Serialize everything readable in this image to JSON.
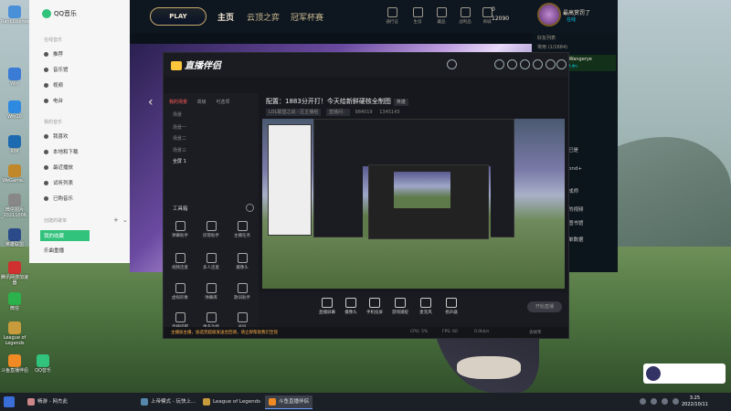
{
  "desktop": {
    "icons": [
      "RankLicense",
      "Win",
      "Win10",
      "RIM",
      "WeGame...",
      "微信图片_20211006...",
      "英雄联盟",
      "腾讯网游加速器",
      "微信",
      "League of Legends",
      "斗鱼直播伴侣",
      "QQ音乐"
    ]
  },
  "qqmusic": {
    "app_name": "QQ音乐",
    "online_section": "在线音乐",
    "online_items": [
      "推荐",
      "音乐馆",
      "视频",
      "电台"
    ],
    "my_section": "我的音乐",
    "my_items": [
      "我喜欢",
      "本地和下载",
      "最近播放",
      "试听列表",
      "已购音乐"
    ],
    "created_section": "创建的歌单",
    "playlists": [
      "我的收藏",
      "乐曲重播"
    ],
    "add_symbol": "+",
    "collapse_symbol": "⌄"
  },
  "lol": {
    "play_label": "PLAY",
    "nav": [
      "主页",
      "云顶之弈",
      "冠军杯赛"
    ],
    "top_icons": [
      "通行证",
      "生涯",
      "藏品",
      "战利品",
      "商城"
    ],
    "currency_be": "0",
    "currency_rp": "12090",
    "username": "最高赏罚了",
    "user_status": "在线",
    "friends_header": "好友列表",
    "friends_group": "常用 (1/1684)",
    "friend_name": "DandhenWangerye",
    "friend_status": "在线 (在选人中)",
    "right_side_labels": [
      "已是",
      "ond+",
      "成师",
      "的视频",
      "图书馆",
      "单数据"
    ]
  },
  "stream": {
    "app_title": "直播伴侣",
    "tabs": [
      "我的场景",
      "高级",
      "可选项"
    ],
    "scenes": [
      "场景",
      "场景一",
      "场景二",
      "场景三",
      "全屏 1"
    ],
    "tools_header": "工具箱",
    "tools": [
      "弹幕助手",
      "房管助手",
      "主播任务",
      "视频连麦",
      "多人连麦",
      "摄像头",
      "虚拟形象",
      "弹幕库",
      "歌词助手",
      "直播提醒",
      "更多功能",
      "录屏"
    ],
    "room_title": "配置：1883分开打！今天给新鲜硬核全制图",
    "room_tag": "英雄",
    "category": "LOL联盟之战 - 区主播组",
    "room_no": "直播间：",
    "viewers": "984019",
    "fans": "1345143",
    "bottom_tools": [
      "直播屏幕",
      "摄像头",
      "手机投屏",
      "游戏捕捉",
      "麦克风",
      "扬声器"
    ],
    "start_label": "开始直播",
    "status_warn": "主播加主播，加选完超级发送合回调，请立即帮助我们至现",
    "status_cpu": "CPU: 5%",
    "status_fps": "FPS: 60",
    "status_bitrate": "0.0kb/s",
    "status_drop": "丢帧率"
  },
  "taskbar": {
    "items": [
      "畅游 - 网杰此",
      "上帝模式 - 玩快上...",
      "League of Legends",
      "斗鱼直播伴侣"
    ],
    "time": "3:25",
    "date": "2022/10/11"
  }
}
